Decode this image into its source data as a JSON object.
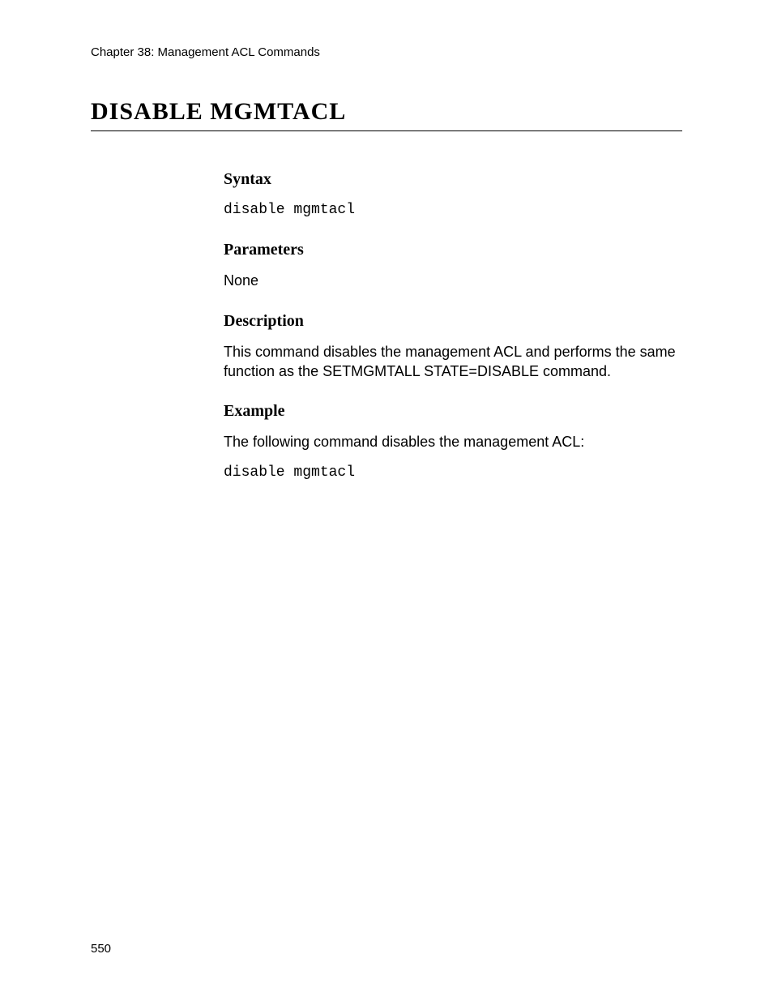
{
  "header": {
    "chapterLine": "Chapter 38: Management ACL Commands"
  },
  "title": "DISABLE MGMTACL",
  "sections": {
    "syntax": {
      "heading": "Syntax",
      "command": "disable mgmtacl"
    },
    "parameters": {
      "heading": "Parameters",
      "value": "None"
    },
    "description": {
      "heading": "Description",
      "text": "This command disables the management ACL and performs the same function as the SETMGMTALL STATE=DISABLE command."
    },
    "example": {
      "heading": "Example",
      "intro": "The following command disables the management ACL:",
      "command": "disable mgmtacl"
    }
  },
  "pageNumber": "550"
}
